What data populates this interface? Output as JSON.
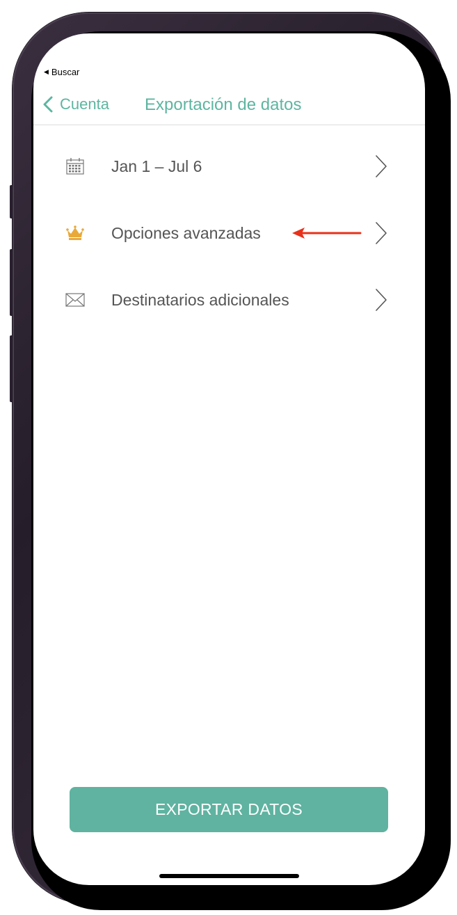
{
  "status": {
    "back_app_label": "Buscar"
  },
  "nav": {
    "back_label": "Cuenta",
    "title": "Exportación de datos"
  },
  "rows": [
    {
      "icon": "calendar-icon",
      "label": "Jan 1 – Jul 6"
    },
    {
      "icon": "crown-icon",
      "label": "Opciones avanzadas"
    },
    {
      "icon": "envelope-icon",
      "label": "Destinatarios adicionales"
    }
  ],
  "export_button": {
    "label": "EXPORTAR DATOS"
  },
  "colors": {
    "accent": "#5db5a0",
    "button": "#5fb3a0",
    "crown": "#e9a93a",
    "annotation_arrow": "#e8311a",
    "text": "#555555"
  }
}
